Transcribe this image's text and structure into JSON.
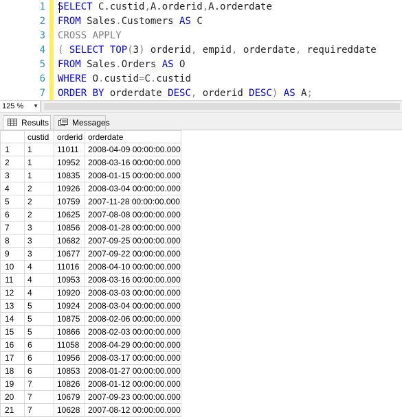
{
  "editor": {
    "lines": [
      {
        "num": "1",
        "segments": [
          {
            "t": "SELECT",
            "c": "kw"
          },
          {
            "t": " C.custid",
            "c": "plain"
          },
          {
            "t": ",",
            "c": "gray"
          },
          {
            "t": "A.orderid",
            "c": "plain"
          },
          {
            "t": ",",
            "c": "gray"
          },
          {
            "t": "A.orderdate",
            "c": "plain"
          }
        ]
      },
      {
        "num": "2",
        "segments": [
          {
            "t": "FROM",
            "c": "kw"
          },
          {
            "t": " Sales",
            "c": "plain"
          },
          {
            "t": ".",
            "c": "gray"
          },
          {
            "t": "Customers ",
            "c": "plain"
          },
          {
            "t": "AS",
            "c": "kw"
          },
          {
            "t": " C",
            "c": "plain"
          }
        ]
      },
      {
        "num": "3",
        "segments": [
          {
            "t": "CROSS APPLY",
            "c": "gray"
          }
        ]
      },
      {
        "num": "4",
        "segments": [
          {
            "t": "(",
            "c": "gray"
          },
          {
            "t": " SELECT",
            "c": "kw"
          },
          {
            "t": " ",
            "c": "plain"
          },
          {
            "t": "TOP",
            "c": "kw"
          },
          {
            "t": "(",
            "c": "gray"
          },
          {
            "t": "3",
            "c": "plain"
          },
          {
            "t": ")",
            "c": "gray"
          },
          {
            "t": " orderid",
            "c": "plain"
          },
          {
            "t": ",",
            "c": "gray"
          },
          {
            "t": " empid",
            "c": "plain"
          },
          {
            "t": ",",
            "c": "gray"
          },
          {
            "t": " orderdate",
            "c": "plain"
          },
          {
            "t": ",",
            "c": "gray"
          },
          {
            "t": " requireddate",
            "c": "plain"
          }
        ]
      },
      {
        "num": "5",
        "segments": [
          {
            "t": "FROM",
            "c": "kw"
          },
          {
            "t": " Sales",
            "c": "plain"
          },
          {
            "t": ".",
            "c": "gray"
          },
          {
            "t": "Orders ",
            "c": "plain"
          },
          {
            "t": "AS",
            "c": "kw"
          },
          {
            "t": " O",
            "c": "plain"
          }
        ]
      },
      {
        "num": "6",
        "segments": [
          {
            "t": "WHERE",
            "c": "kw"
          },
          {
            "t": " O",
            "c": "plain"
          },
          {
            "t": ".",
            "c": "gray"
          },
          {
            "t": "custid",
            "c": "plain"
          },
          {
            "t": "=",
            "c": "gray"
          },
          {
            "t": "C",
            "c": "plain"
          },
          {
            "t": ".",
            "c": "gray"
          },
          {
            "t": "custid",
            "c": "plain"
          }
        ]
      },
      {
        "num": "7",
        "segments": [
          {
            "t": "ORDER BY",
            "c": "kw"
          },
          {
            "t": " orderdate ",
            "c": "plain"
          },
          {
            "t": "DESC",
            "c": "kw"
          },
          {
            "t": ",",
            "c": "gray"
          },
          {
            "t": " orderid ",
            "c": "plain"
          },
          {
            "t": "DESC",
            "c": "kw"
          },
          {
            "t": ")",
            "c": "gray"
          },
          {
            "t": " ",
            "c": "plain"
          },
          {
            "t": "AS",
            "c": "kw"
          },
          {
            "t": " A",
            "c": "plain"
          },
          {
            "t": ";",
            "c": "gray"
          }
        ]
      }
    ]
  },
  "zoom": {
    "value": "125 %"
  },
  "tabs": {
    "results": "Results",
    "messages": "Messages"
  },
  "grid": {
    "columns": [
      "custid",
      "orderid",
      "orderdate"
    ],
    "rows": [
      [
        "1",
        "1",
        "11011",
        "2008-04-09 00:00:00.000"
      ],
      [
        "2",
        "1",
        "10952",
        "2008-03-16 00:00:00.000"
      ],
      [
        "3",
        "1",
        "10835",
        "2008-01-15 00:00:00.000"
      ],
      [
        "4",
        "2",
        "10926",
        "2008-03-04 00:00:00.000"
      ],
      [
        "5",
        "2",
        "10759",
        "2007-11-28 00:00:00.000"
      ],
      [
        "6",
        "2",
        "10625",
        "2007-08-08 00:00:00.000"
      ],
      [
        "7",
        "3",
        "10856",
        "2008-01-28 00:00:00.000"
      ],
      [
        "8",
        "3",
        "10682",
        "2007-09-25 00:00:00.000"
      ],
      [
        "9",
        "3",
        "10677",
        "2007-09-22 00:00:00.000"
      ],
      [
        "10",
        "4",
        "11016",
        "2008-04-10 00:00:00.000"
      ],
      [
        "11",
        "4",
        "10953",
        "2008-03-16 00:00:00.000"
      ],
      [
        "12",
        "4",
        "10920",
        "2008-03-03 00:00:00.000"
      ],
      [
        "13",
        "5",
        "10924",
        "2008-03-04 00:00:00.000"
      ],
      [
        "14",
        "5",
        "10875",
        "2008-02-06 00:00:00.000"
      ],
      [
        "15",
        "5",
        "10866",
        "2008-02-03 00:00:00.000"
      ],
      [
        "16",
        "6",
        "11058",
        "2008-04-29 00:00:00.000"
      ],
      [
        "17",
        "6",
        "10956",
        "2008-03-17 00:00:00.000"
      ],
      [
        "18",
        "6",
        "10853",
        "2008-01-27 00:00:00.000"
      ],
      [
        "19",
        "7",
        "10826",
        "2008-01-12 00:00:00.000"
      ],
      [
        "20",
        "7",
        "10679",
        "2007-09-23 00:00:00.000"
      ],
      [
        "21",
        "7",
        "10628",
        "2007-08-12 00:00:00.000"
      ]
    ]
  }
}
